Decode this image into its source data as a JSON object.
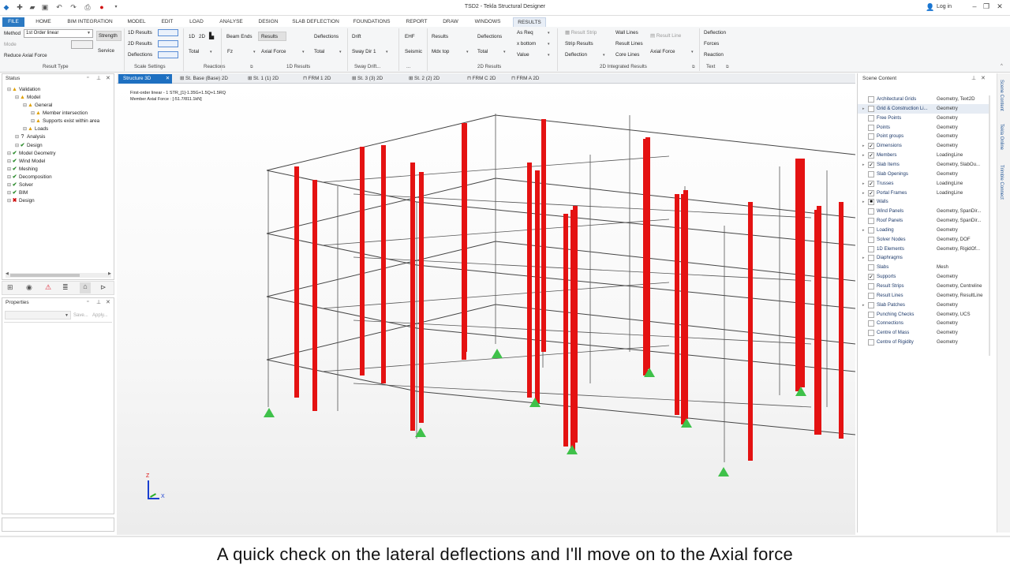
{
  "app": {
    "title": "TSD2 - Tekla Structural Designer",
    "login": "Log in"
  },
  "menu_tabs": [
    "FILE",
    "HOME",
    "BIM INTEGRATION",
    "MODEL",
    "EDIT",
    "LOAD",
    "ANALYSE",
    "DESIGN",
    "SLAB DEFLECTION",
    "FOUNDATIONS",
    "REPORT",
    "DRAW",
    "WINDOWS",
    "RESULTS"
  ],
  "ribbon": {
    "method_label": "Method",
    "method_value": "1st Order linear",
    "mode_label": "Mode",
    "reduce_axial": "Reduce Axial Force",
    "strength": "Strength",
    "service": "Service",
    "results_1d": "1D Results",
    "results_2d": "2D Results",
    "deflections": "Deflections",
    "btn_1d": "1D",
    "btn_2d": "2D",
    "total": "Total",
    "beam_ends": "Beam Ends",
    "results": "Results",
    "fz": "Fz",
    "axial_force": "Axial Force",
    "deflections2": "Deflections",
    "total2": "Total",
    "drift": "Drift",
    "sway_dir1": "Sway Dir 1",
    "ehf": "EHF",
    "seismic": "Seismic",
    "results3": "Results",
    "mdx_top": "Mdx top",
    "deflections3": "Deflections",
    "total3": "Total",
    "as_req": "As Req",
    "x_bottom": "x bottom",
    "value": "Value",
    "result_strip": "Result Strip",
    "strip_results": "Strip Results",
    "deflection": "Deflection",
    "wall_lines": "Wall Lines",
    "result_lines": "Result Lines",
    "core_lines": "Core Lines",
    "result_line": "Result Line",
    "axial_force2": "Axial Force",
    "deflection2": "Deflection",
    "forces": "Forces",
    "reaction": "Reaction",
    "groups": {
      "result_type": "Result Type",
      "scale_settings": "Scale Settings",
      "reactions": "Reactions",
      "results_1d": "1D Results",
      "sway_drift": "Sway Drift...",
      "dots": "...",
      "results_2d": "2D Results",
      "integrated": "2D Integrated Results",
      "text": "Text"
    }
  },
  "status_panel": {
    "title": "Status",
    "items": [
      {
        "label": "Validation",
        "icon": "tri",
        "indent": 0
      },
      {
        "label": "Model",
        "icon": "tri",
        "indent": 1
      },
      {
        "label": "General",
        "icon": "tri",
        "indent": 2
      },
      {
        "label": "Member intersection",
        "icon": "tri",
        "indent": 3
      },
      {
        "label": "Supports exist within area",
        "icon": "tri",
        "indent": 3
      },
      {
        "label": "Loads",
        "icon": "tri",
        "indent": 2
      },
      {
        "label": "Analysis",
        "icon": "q",
        "indent": 1
      },
      {
        "label": "Design",
        "icon": "chk",
        "indent": 1
      },
      {
        "label": "Model Geometry",
        "icon": "chk",
        "indent": 0
      },
      {
        "label": "Wind Model",
        "icon": "chk",
        "indent": 0
      },
      {
        "label": "Meshing",
        "icon": "chk",
        "indent": 0
      },
      {
        "label": "Decomposition",
        "icon": "chk",
        "indent": 0
      },
      {
        "label": "Solver",
        "icon": "chk",
        "indent": 0
      },
      {
        "label": "BIM",
        "icon": "chk",
        "indent": 0
      },
      {
        "label": "Design",
        "icon": "x",
        "indent": 0
      }
    ]
  },
  "properties_panel": {
    "title": "Properties",
    "save": "Save...",
    "apply": "Apply..."
  },
  "doc_tabs": [
    "Structure 3D",
    "St. Base (Base) 2D",
    "St. 1 (1) 2D",
    "FRM 1 2D",
    "St. 3 (3) 2D",
    "St. 2 (2) 2D",
    "FRM C 2D",
    "FRM A 2D"
  ],
  "viewport": {
    "info_line1": "First-order linear - 1 STR_[1]-1.35G+1.5Q+1.5RQ",
    "info_line2": "Member Axial Force : [-51.7/811.1kN]",
    "axis_z": "Z",
    "axis_x": "X"
  },
  "scene_content": {
    "title": "Scene Content",
    "rows": [
      {
        "name": "Architectural Grids",
        "type": "Geometry, Text2D",
        "checked": false,
        "arrow": false
      },
      {
        "name": "Grid & Construction Li...",
        "type": "Geometry",
        "checked": false,
        "arrow": true,
        "highlight": true
      },
      {
        "name": "Free Points",
        "type": "Geometry",
        "checked": false,
        "arrow": false
      },
      {
        "name": "Points",
        "type": "Geometry",
        "checked": false,
        "arrow": false
      },
      {
        "name": "Point groups",
        "type": "Geometry",
        "checked": false,
        "arrow": false
      },
      {
        "name": "Dimensions",
        "type": "Geometry",
        "checked": true,
        "arrow": true
      },
      {
        "name": "Members",
        "type": "LoadingLine",
        "checked": true,
        "arrow": true
      },
      {
        "name": "Slab Items",
        "type": "Geometry, SlabOu...",
        "checked": true,
        "arrow": true
      },
      {
        "name": "Slab Openings",
        "type": "Geometry",
        "checked": false,
        "arrow": false
      },
      {
        "name": "Trusses",
        "type": "LoadingLine",
        "checked": true,
        "arrow": true
      },
      {
        "name": "Portal Frames",
        "type": "LoadingLine",
        "checked": true,
        "arrow": true
      },
      {
        "name": "Walls",
        "type": "",
        "checked": "partial",
        "arrow": true
      },
      {
        "name": "Wind Panels",
        "type": "Geometry, SpanDir...",
        "checked": false,
        "arrow": false
      },
      {
        "name": "Roof Panels",
        "type": "Geometry, SpanDir...",
        "checked": false,
        "arrow": false
      },
      {
        "name": "Loading",
        "type": "Geometry",
        "checked": false,
        "arrow": true
      },
      {
        "name": "Solver Nodes",
        "type": "Geometry, DOF",
        "checked": false,
        "arrow": false
      },
      {
        "name": "1D Elements",
        "type": "Geometry, RigidOf...",
        "checked": false,
        "arrow": false
      },
      {
        "name": "Diaphragms",
        "type": "",
        "checked": false,
        "arrow": true
      },
      {
        "name": "Slabs",
        "type": "Mesh",
        "checked": false,
        "arrow": false
      },
      {
        "name": "Supports",
        "type": "Geometry",
        "checked": true,
        "arrow": false
      },
      {
        "name": "Result Strips",
        "type": "Geometry, Centreline",
        "checked": false,
        "arrow": false
      },
      {
        "name": "Result Lines",
        "type": "Geometry, ResultLine",
        "checked": false,
        "arrow": false
      },
      {
        "name": "Slab Patches",
        "type": "Geometry",
        "checked": false,
        "arrow": true
      },
      {
        "name": "Punching Checks",
        "type": "Geometry, UCS",
        "checked": false,
        "arrow": false
      },
      {
        "name": "Connections",
        "type": "Geometry",
        "checked": false,
        "arrow": false
      },
      {
        "name": "Centre of Mass",
        "type": "Geometry",
        "checked": false,
        "arrow": false
      },
      {
        "name": "Centre of Rigidity",
        "type": "Geometry",
        "checked": false,
        "arrow": false
      }
    ]
  },
  "side_tabs": [
    "Scene Content",
    "Tekla Online",
    "Trimble Connect"
  ],
  "caption": "A quick check on the lateral deflections and I'll move on to the Axial force",
  "colors": {
    "accent": "#2b79c2",
    "force": "#e41212",
    "support": "#3fc14a"
  }
}
